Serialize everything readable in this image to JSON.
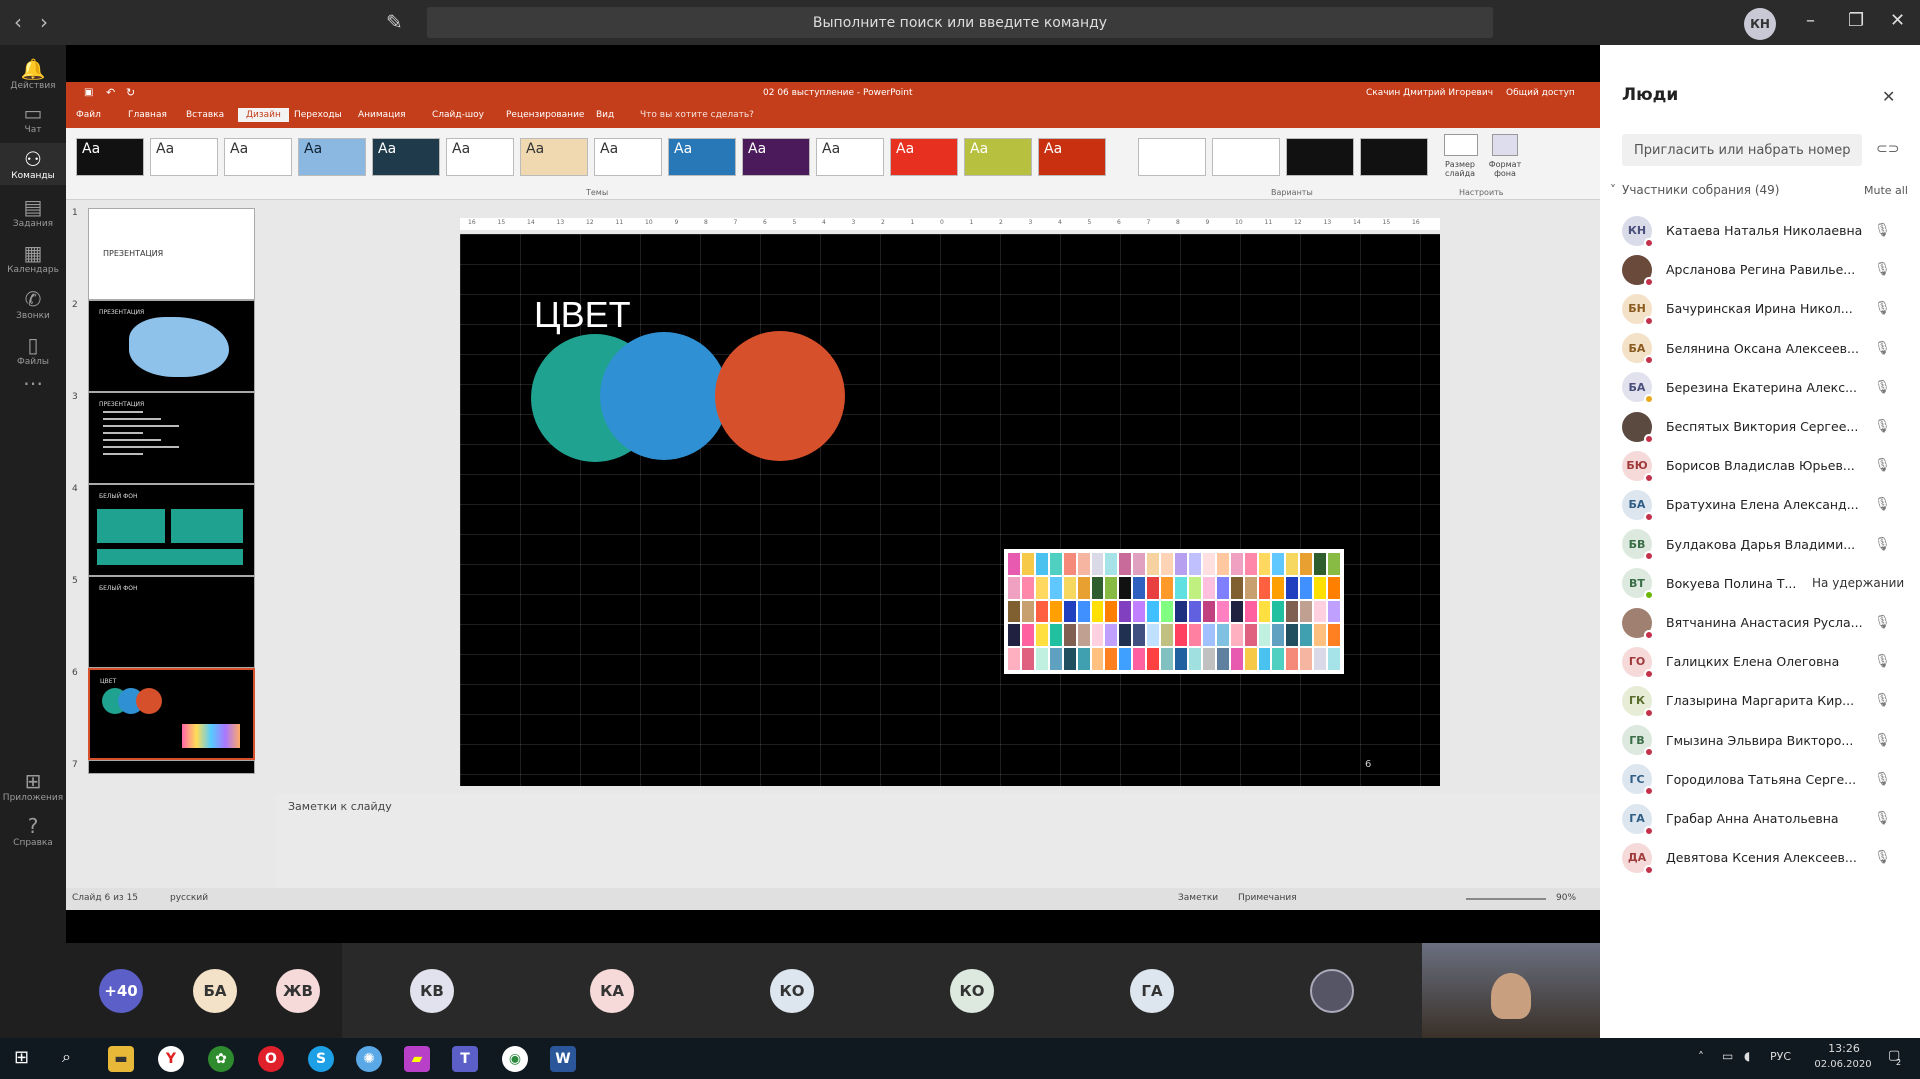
{
  "teams": {
    "search_placeholder": "Выполните поиск или введите команду",
    "user_initials": "КН",
    "rail": [
      {
        "label": "Действия",
        "icon": "bell-icon",
        "glyph": "🔔"
      },
      {
        "label": "Чат",
        "icon": "chat-icon",
        "glyph": "▭"
      },
      {
        "label": "Команды",
        "icon": "teams-icon",
        "glyph": "⚇"
      },
      {
        "label": "Задания",
        "icon": "assignments-icon",
        "glyph": "▤"
      },
      {
        "label": "Календарь",
        "icon": "calendar-icon",
        "glyph": "▦"
      },
      {
        "label": "Звонки",
        "icon": "phone-icon",
        "glyph": "✆"
      },
      {
        "label": "Файлы",
        "icon": "files-icon",
        "glyph": "▯"
      },
      {
        "label": "...",
        "icon": "more-icon",
        "glyph": "⋯"
      },
      {
        "label": "Приложения",
        "icon": "apps-icon",
        "glyph": "⊞"
      },
      {
        "label": "Справка",
        "icon": "help-icon",
        "glyph": "?"
      }
    ]
  },
  "ppt": {
    "title": "02 06 выступление - PowerPoint",
    "user": "Скачин Дмитрий Игоревич",
    "share": "Общий доступ",
    "tabs": [
      "Файл",
      "Главная",
      "Вставка",
      "Дизайн",
      "Переходы",
      "Анимация",
      "Слайд-шоу",
      "Рецензирование",
      "Вид"
    ],
    "tell_me": "Что вы хотите сделать?",
    "themes_label": "Темы",
    "variants_label": "Варианты",
    "customize_label": "Настроить",
    "slide_size": "Размер слайда",
    "format_bg": "Формат фона",
    "theme_glyph": "Aa",
    "slides": [
      {
        "n": "1",
        "text": "ПРЕЗЕНТАЦИЯ"
      },
      {
        "n": "2",
        "text": "ПРЕЗЕНТАЦИЯ"
      },
      {
        "n": "3",
        "text": "ПРЕЗЕНТАЦИЯ"
      },
      {
        "n": "4",
        "text": "БЕЛЫЙ ФОН"
      },
      {
        "n": "5",
        "text": "БЕЛЫЙ ФОН"
      },
      {
        "n": "6",
        "text": "ЦВЕТ"
      },
      {
        "n": "7",
        "text": ""
      }
    ],
    "current_slide": {
      "title": "ЦВЕТ",
      "page": "6"
    },
    "notes": "Заметки к слайду",
    "status": {
      "slide": "Слайд 6 из 15",
      "lang": "русский",
      "notes": "Заметки",
      "comments": "Примечания",
      "zoom": "90%"
    },
    "ruler_ticks": [
      "16",
      "15",
      "14",
      "13",
      "12",
      "11",
      "10",
      "9",
      "8",
      "7",
      "6",
      "5",
      "4",
      "3",
      "2",
      "1",
      "0",
      "1",
      "2",
      "3",
      "4",
      "5",
      "6",
      "7",
      "8",
      "9",
      "10",
      "11",
      "12",
      "13",
      "14",
      "15",
      "16"
    ]
  },
  "people": {
    "title": "Люди",
    "invite": "Пригласить или набрать номер",
    "participants": "Участники собрания (49)",
    "mute_all": "Mute all",
    "on_hold": "На удержании",
    "list": [
      {
        "initials": "КН",
        "name": "Катаева Наталья Николаевна",
        "bg": "#d9dbe8",
        "fg": "#4a4f7c"
      },
      {
        "initials": "",
        "name": "Арсланова Регина Равилье...",
        "bg": "#6a4a3a",
        "fg": "#fff"
      },
      {
        "initials": "БН",
        "name": "Бачуринская Ирина Никол...",
        "bg": "#f4e2c8",
        "fg": "#8a5a1e"
      },
      {
        "initials": "БА",
        "name": "Белянина Оксана Алексеев...",
        "bg": "#f4e2c8",
        "fg": "#8a5a1e"
      },
      {
        "initials": "БА",
        "name": "Березина Екатерина Алекс...",
        "bg": "#e2e2ee",
        "fg": "#4a4f7c"
      },
      {
        "initials": "",
        "name": "Беспятых Виктория Сергее...",
        "bg": "#5a4a40",
        "fg": "#fff"
      },
      {
        "initials": "БЮ",
        "name": "Борисов Владислав Юрьев...",
        "bg": "#f6dada",
        "fg": "#a03a3a"
      },
      {
        "initials": "БА",
        "name": "Братухина Елена Александ...",
        "bg": "#dde6ef",
        "fg": "#2f5e86"
      },
      {
        "initials": "БВ",
        "name": "Булдакова Дарья Владими...",
        "bg": "#dde9df",
        "fg": "#3a6e46"
      },
      {
        "initials": "ВТ",
        "name": "Вокуева Полина Т...",
        "bg": "#dde9df",
        "fg": "#3a6e46"
      },
      {
        "initials": "",
        "name": "Вятчанина Анастасия Русла...",
        "bg": "#a08070",
        "fg": "#fff"
      },
      {
        "initials": "ГО",
        "name": "Галицких Елена Олеговна",
        "bg": "#f6dada",
        "fg": "#a03a3a"
      },
      {
        "initials": "ГК",
        "name": "Глазырина Маргарита Кир...",
        "bg": "#e6ecd6",
        "fg": "#5a6e2e"
      },
      {
        "initials": "ГВ",
        "name": "Гмызина Эльвира Викторо...",
        "bg": "#dde9df",
        "fg": "#3a6e46"
      },
      {
        "initials": "ГС",
        "name": "Городилова Татьяна Серге...",
        "bg": "#dde6ef",
        "fg": "#2f5e86"
      },
      {
        "initials": "ГА",
        "name": "Грабар Анна Анатольевна",
        "bg": "#dde6ef",
        "fg": "#2f5e86"
      },
      {
        "initials": "ДА",
        "name": "Девятова Ксения Алексеев...",
        "bg": "#f6dada",
        "fg": "#a03a3a"
      }
    ]
  },
  "call": {
    "overflow": "+40",
    "tiles": [
      {
        "initials": "БА",
        "bg": "#f4e2c8"
      },
      {
        "initials": "ЖВ",
        "bg": "#f6dada"
      },
      {
        "initials": "КВ",
        "bg": "#e2e2ee"
      },
      {
        "initials": "КА",
        "bg": "#f6dada"
      },
      {
        "initials": "КО",
        "bg": "#dde6ef"
      },
      {
        "initials": "КО",
        "bg": "#dde9df"
      },
      {
        "initials": "ГА",
        "bg": "#dde6ef"
      }
    ]
  },
  "taskbar": {
    "lang": "РУС",
    "time": "13:26",
    "date": "02.06.2020",
    "notif": "2"
  },
  "colors": {
    "teal": "#1fa28f",
    "blue": "#2f91d3",
    "orange": "#d6512b",
    "ppt_red": "#c43e1c"
  }
}
